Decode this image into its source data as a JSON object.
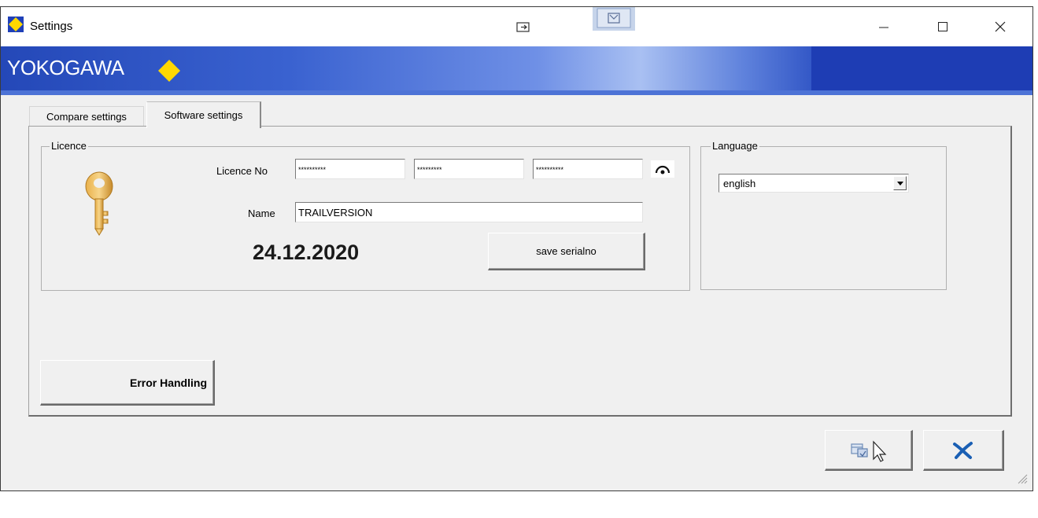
{
  "window": {
    "title": "Settings",
    "icons": {
      "app": "yokogawa-diamond-icon",
      "snap": "snap-layout-icon",
      "center": "window-tab-icon",
      "minimize": "minimize-icon",
      "maximize": "maximize-icon",
      "close": "close-icon"
    }
  },
  "banner": {
    "logo_text": "YOKOGAWA"
  },
  "tabs": [
    {
      "label": "Compare settings",
      "active": false
    },
    {
      "label": "Software settings",
      "active": true
    }
  ],
  "licence": {
    "group_label": "Licence",
    "licence_no_label": "Licence No",
    "licence_no_values": [
      "**********",
      "*********",
      "**********"
    ],
    "name_label": "Name",
    "name_value": "TRAILVERSION",
    "date": "24.12.2020",
    "save_button": "save serialno",
    "icons": {
      "key": "key-icon",
      "show_password": "eye-icon"
    }
  },
  "language": {
    "group_label": "Language",
    "selected": "english"
  },
  "buttons": {
    "error_handling": "Error Handling",
    "ok_icon": "apply-cursor-icon",
    "cancel_icon": "cancel-x-icon"
  },
  "colors": {
    "banner_blue": "#2448b8",
    "brand_yellow": "#ffd800",
    "cancel_x": "#1a5fb4"
  }
}
